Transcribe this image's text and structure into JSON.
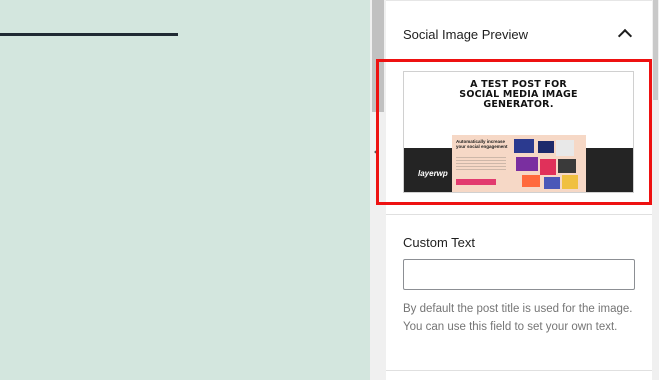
{
  "panel": {
    "title": "Social Image Preview",
    "toggle_icon": "chevron-up-icon"
  },
  "preview": {
    "headline_line1": "A TEST POST FOR",
    "headline_line2": "SOCIAL MEDIA IMAGE",
    "headline_line3": "GENERATOR.",
    "logo": "layerwp",
    "card_title": "Automatically increase your social engagement",
    "highlight_color": "#ee1111"
  },
  "custom_text": {
    "label": "Custom Text",
    "value": "",
    "help": "By default the post title is used for the image. You can use this field to set your own text."
  },
  "colors": {
    "canvas_bg": "#d3e6de",
    "accent_button": "#e23b6f"
  }
}
